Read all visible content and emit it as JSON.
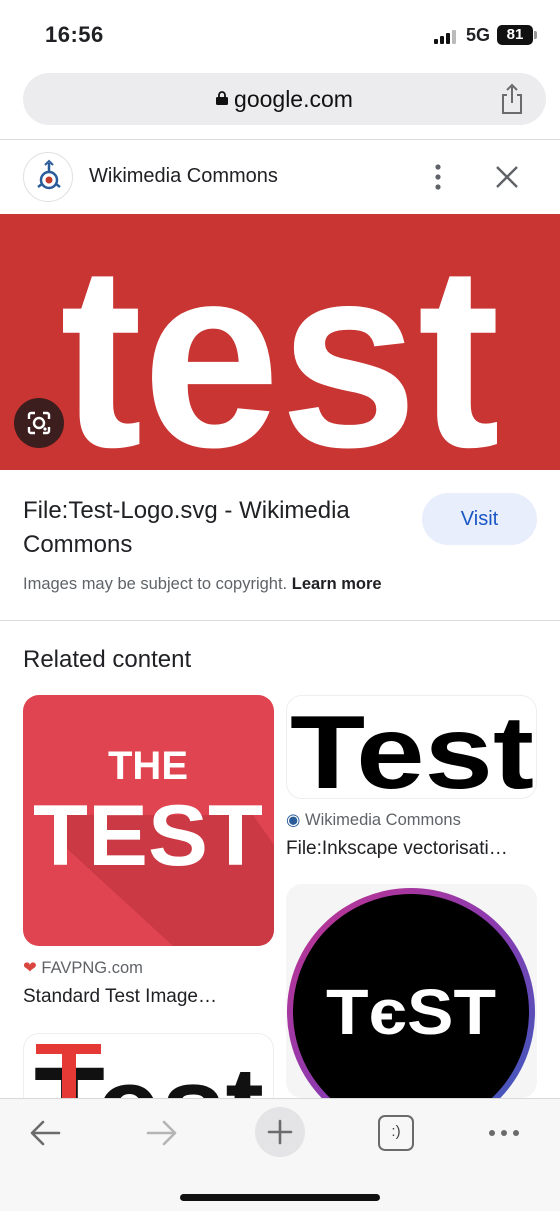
{
  "status_bar": {
    "time": "16:56",
    "network": "5G",
    "battery": "81"
  },
  "url_bar": {
    "url": "google.com"
  },
  "source_header": {
    "name": "Wikimedia Commons"
  },
  "hero": {
    "image_text": "test",
    "background": "#c93532"
  },
  "result": {
    "title": "File:Test-Logo.svg - Wikimedia Commons",
    "visit_label": "Visit",
    "copyright_text": "Images may be subject to copyright.",
    "learn_more": "Learn more"
  },
  "related": {
    "heading": "Related content",
    "items": [
      {
        "image_text_line1": "THE",
        "image_text_line2": "TEST",
        "source": "FAVPNG.com",
        "title": "Standard Test Image…"
      },
      {
        "image_text": "Test",
        "source": "Wikimedia Commons",
        "title": "File:Inkscape vectorisati…"
      },
      {
        "image_text": "TєST"
      },
      {
        "image_text": "Test"
      }
    ]
  },
  "toolbar": {
    "tabs_label": ":)"
  }
}
